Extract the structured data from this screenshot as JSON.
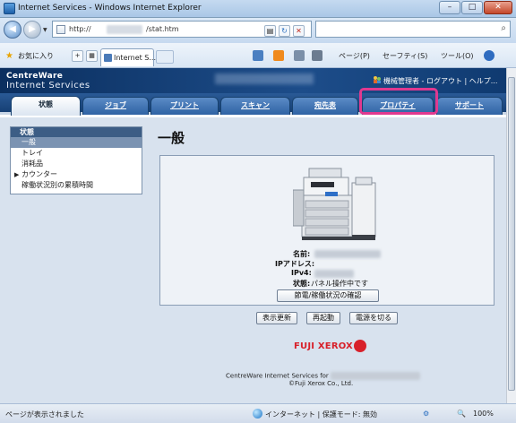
{
  "browser": {
    "window_title": "Internet Services - Windows Internet Explorer",
    "url_prefix": "http://",
    "url_path": "/stat.htm",
    "favorites_label": "お気に入り",
    "tab_title": "Internet S...",
    "command_items": [
      "ページ(P)",
      "セーフティ(S)",
      "ツール(O)"
    ],
    "status_text": "ページが表示されました",
    "zone_text": "インターネット | 保護モード: 無効",
    "zoom": "100%"
  },
  "header": {
    "logo_line1": "CentreWare",
    "logo_line2": "Internet Services",
    "user_text": "機械管理者 - ログアウト | ヘルプ..."
  },
  "tabs": [
    {
      "label": "状態",
      "active": true
    },
    {
      "label": "ジョブ",
      "active": false
    },
    {
      "label": "プリント",
      "active": false
    },
    {
      "label": "スキャン",
      "active": false
    },
    {
      "label": "宛先表",
      "active": false
    },
    {
      "label": "プロパティ",
      "active": false
    },
    {
      "label": "サポート",
      "active": false
    }
  ],
  "sidebar": {
    "heading": "状態",
    "items": [
      {
        "label": "一般",
        "selected": true,
        "expandable": false
      },
      {
        "label": "トレイ",
        "selected": false,
        "expandable": false
      },
      {
        "label": "消耗品",
        "selected": false,
        "expandable": false
      },
      {
        "label": "カウンター",
        "selected": false,
        "expandable": true
      },
      {
        "label": "稼働状況別の累積時間",
        "selected": false,
        "expandable": false
      }
    ]
  },
  "main": {
    "title": "一般",
    "labels": {
      "name": "名前:",
      "ip": "IPアドレス:",
      "ipv4": "IPv4:",
      "status": "状態:"
    },
    "status_value": "パネル操作中です",
    "power_button": "節電/稼働状況の確認",
    "buttons": {
      "refresh": "表示更新",
      "reboot": "再起動",
      "power_off": "電源を切る"
    }
  },
  "footer": {
    "brand": "FUJI XEROX",
    "line1": "CentreWare Internet Services for",
    "line2": "©Fuji Xerox Co., Ltd."
  },
  "colors": {
    "highlight": "#e0398f",
    "header_bg": "#0b2f5f",
    "brand_red": "#d8202a"
  }
}
